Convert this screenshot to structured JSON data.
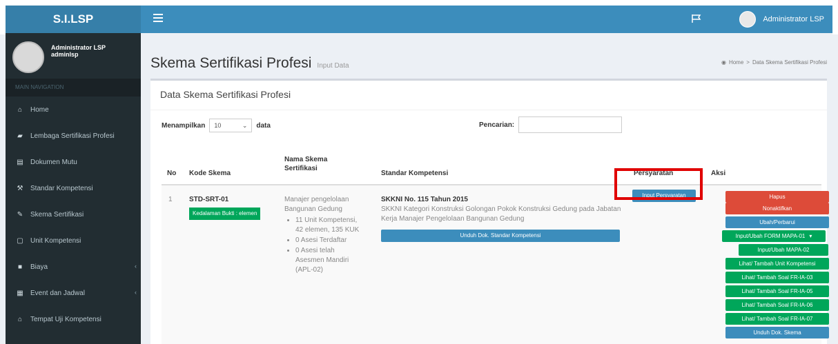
{
  "app": {
    "title": "S.I.LSP"
  },
  "topbar": {
    "user_name": "Administrator LSP"
  },
  "sidebar": {
    "user_name": "Administrator LSP",
    "user_login": "adminlsp",
    "header": "MAIN NAVIGATION",
    "items": [
      {
        "label": "Home",
        "icon": "home-icon",
        "glyph": "⌂",
        "has_children": false
      },
      {
        "label": "Lembaga Sertifikasi Profesi",
        "icon": "graduation-cap-icon",
        "glyph": "▰",
        "has_children": false
      },
      {
        "label": "Dokumen Mutu",
        "icon": "document-icon",
        "glyph": "▤",
        "has_children": false
      },
      {
        "label": "Standar Kompetensi",
        "icon": "gavel-icon",
        "glyph": "⚒",
        "has_children": false
      },
      {
        "label": "Skema Sertifikasi",
        "icon": "edit-icon",
        "glyph": "✎",
        "has_children": false
      },
      {
        "label": "Unit Kompetensi",
        "icon": "file-text-icon",
        "glyph": "▢",
        "has_children": false
      },
      {
        "label": "Biaya",
        "icon": "money-icon",
        "glyph": "■",
        "has_children": true
      },
      {
        "label": "Event dan Jadwal",
        "icon": "calendar-icon",
        "glyph": "▦",
        "has_children": true
      },
      {
        "label": "Tempat Uji Kompetensi",
        "icon": "bank-icon",
        "glyph": "⌂",
        "has_children": false
      }
    ]
  },
  "page": {
    "title": "Skema Sertifikasi Profesi",
    "subtitle": "Input Data",
    "breadcrumb": [
      "Home",
      "Data Skema Sertifikasi Profesi"
    ]
  },
  "box": {
    "title": "Data Skema Sertifikasi Profesi",
    "length_prefix": "Menampilkan",
    "length_value": "10",
    "length_suffix": "data",
    "search_label": "Pencarian:",
    "search_value": ""
  },
  "table": {
    "headers": [
      "No",
      "Kode Skema",
      "Nama Skema Sertifikasi",
      "Standar Kompetensi",
      "Persyaratan",
      "Aksi"
    ],
    "row": {
      "no": "1",
      "kode": "STD-SRT-01",
      "kode_badge": "Kedalaman Bukti : elemen",
      "nama": "Manajer pengelolaan Bangunan Gedung",
      "nama_items": [
        "11 Unit Kompetensi, 42 elemen, 135 KUK",
        "0 Asesi Terdaftar",
        "0 Asesi telah Asesmen Mandiri (APL-02)"
      ],
      "standar_title": "SKKNI No. 115 Tahun 2015",
      "standar_desc": "SKKNI Kategori Konstruksi Golongan Pokok Konstruksi Gedung pada Jabatan Kerja Manajer Pengelolaan Bangunan Gedung",
      "standar_button": "Unduh Dok. Standar Kompetensi",
      "persyaratan_button": "Input Persyaratan",
      "aksi": {
        "hapus": "Hapus",
        "nonaktifkan": "Nonaktifkan",
        "ubah": "Ubah/Perbarui",
        "mapa01": "Input/Ubah FORM MAPA-01",
        "mapa02": "Input/Ubah MAPA-02",
        "unit": "Lihat/ Tambah Unit Kompetensi",
        "ia03": "Lihat/ Tambah Soal FR-IA-03",
        "ia05": "Lihat/ Tambah Soal FR-IA-05",
        "ia06": "Lihat/ Tambah Soal FR-IA-06",
        "ia07": "Lihat/ Tambah Soal FR-IA-07",
        "unduh_skema": "Unduh Dok. Skema"
      }
    }
  },
  "colors": {
    "primary": "#3c8dbc",
    "danger": "#dd4b39",
    "success": "#00a65a",
    "sidebar": "#222d32",
    "highlight": "#e00000"
  }
}
